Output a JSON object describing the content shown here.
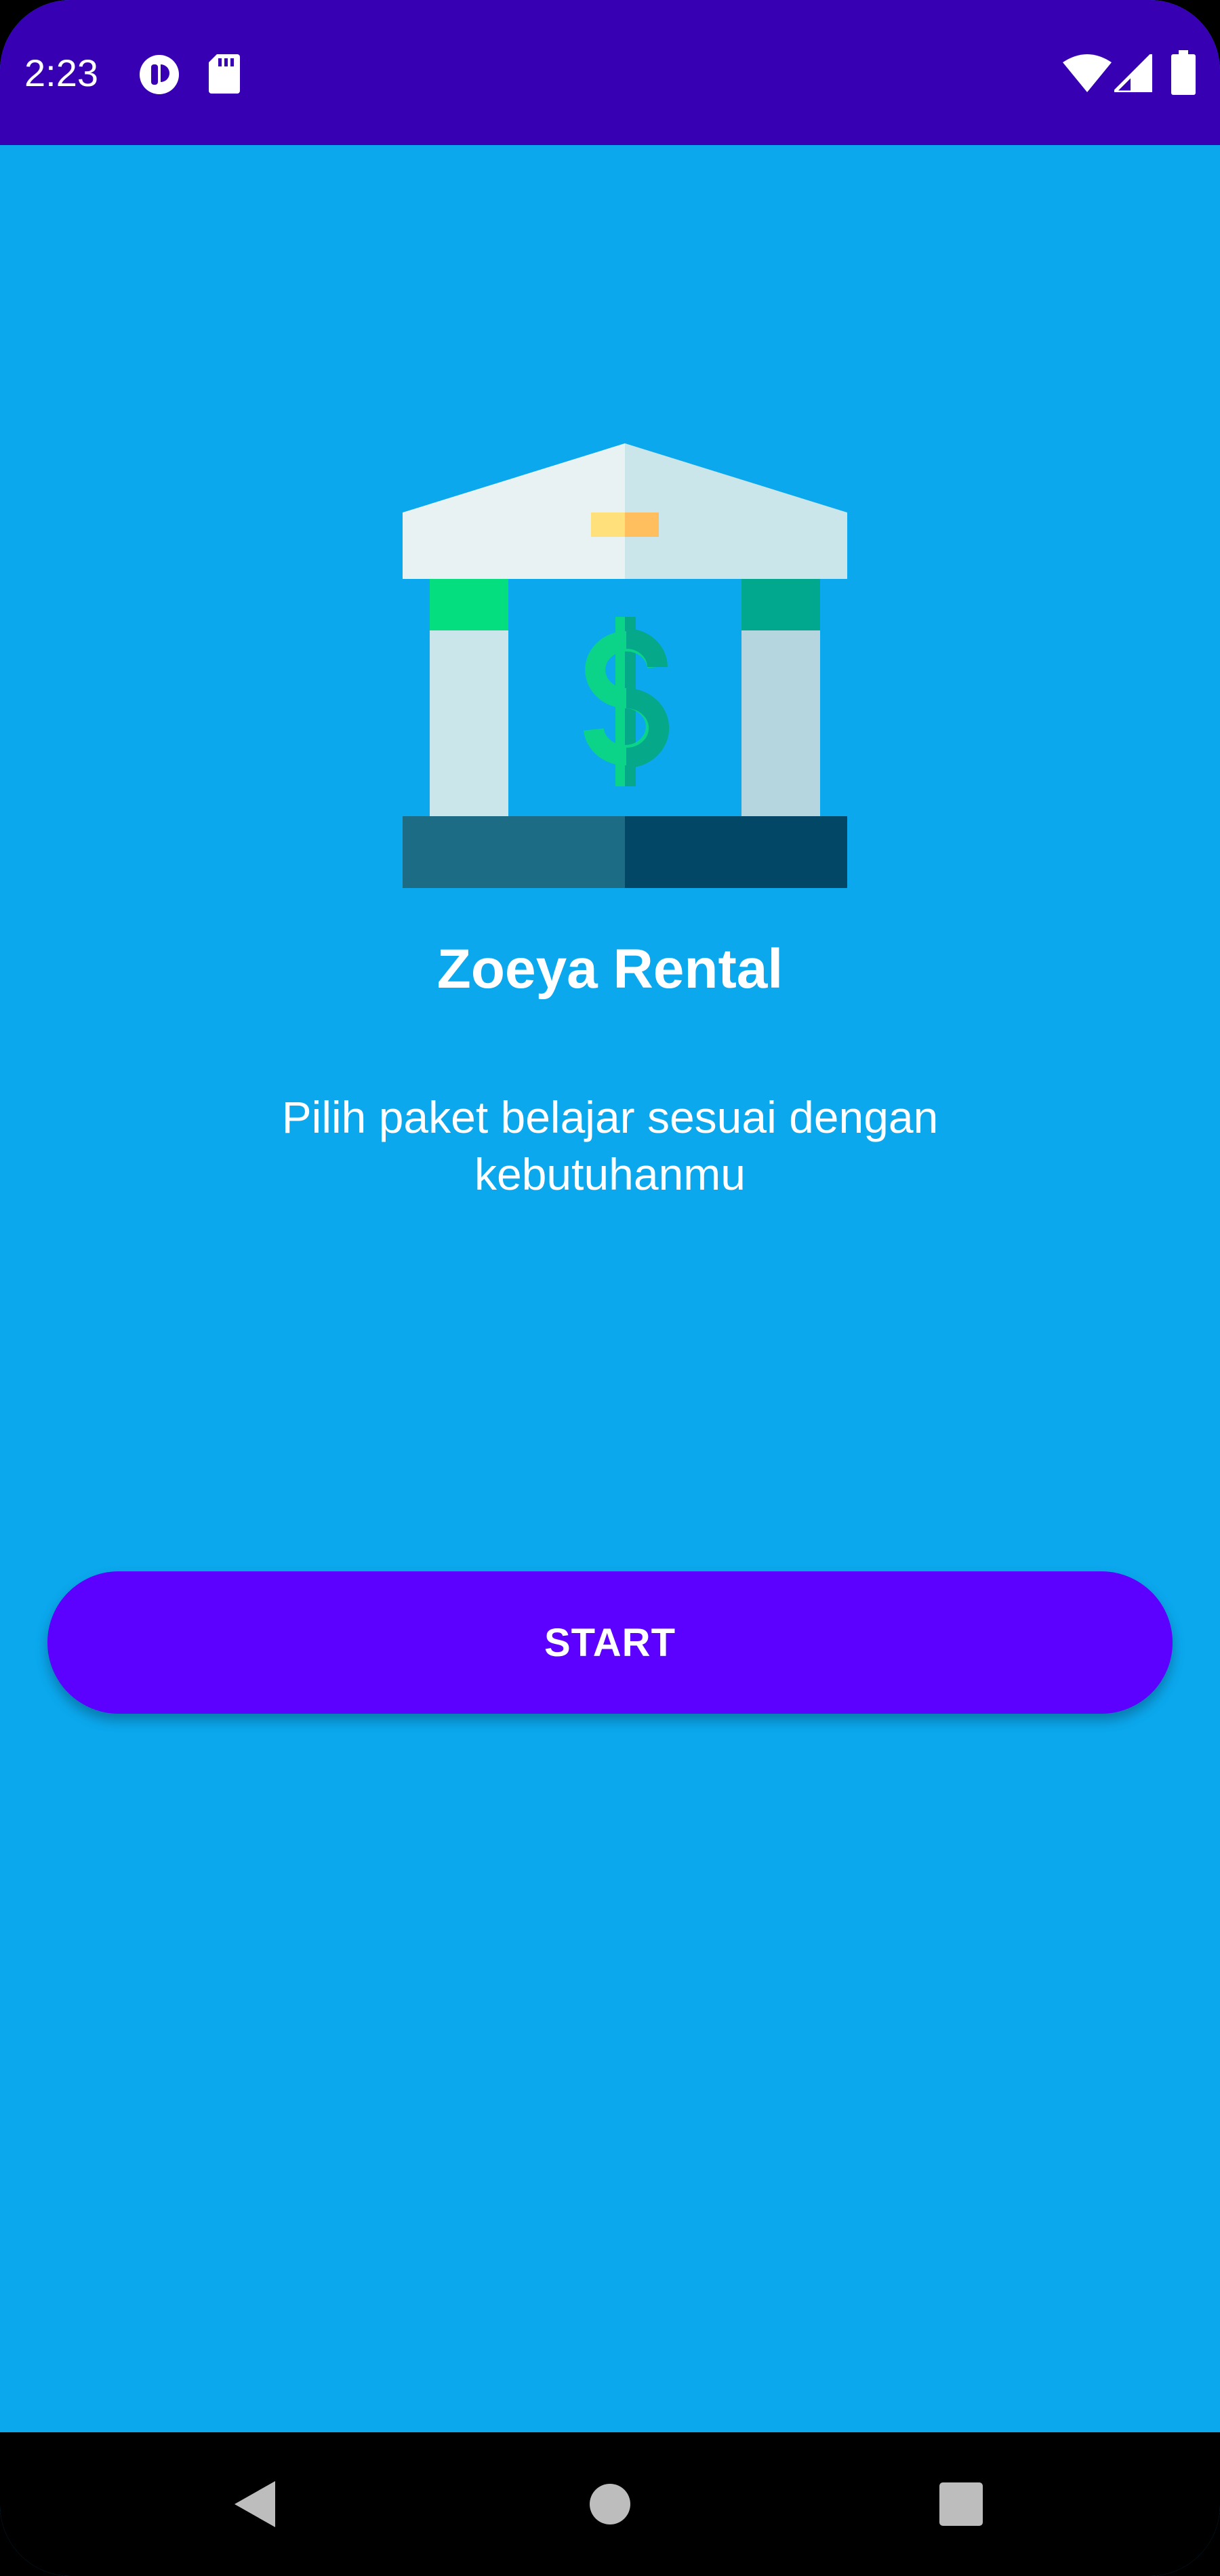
{
  "status_bar": {
    "time": "2:23",
    "left_icons": [
      "notification-app-icon",
      "sd-card-icon"
    ],
    "right_icons": [
      "wifi-icon",
      "cell-signal-icon",
      "battery-icon"
    ],
    "color": "#3700B3"
  },
  "main": {
    "background_color": "#0BA8EE",
    "logo_icon": "bank-dollar-icon",
    "title": "Zoeya Rental",
    "subtitle": "Pilih paket belajar sesuai dengan kebutuhanmu"
  },
  "start_button": {
    "label": "START",
    "color": "#5C00FF"
  },
  "nav_bar": {
    "buttons": [
      "back-icon",
      "home-icon",
      "recents-icon"
    ]
  }
}
